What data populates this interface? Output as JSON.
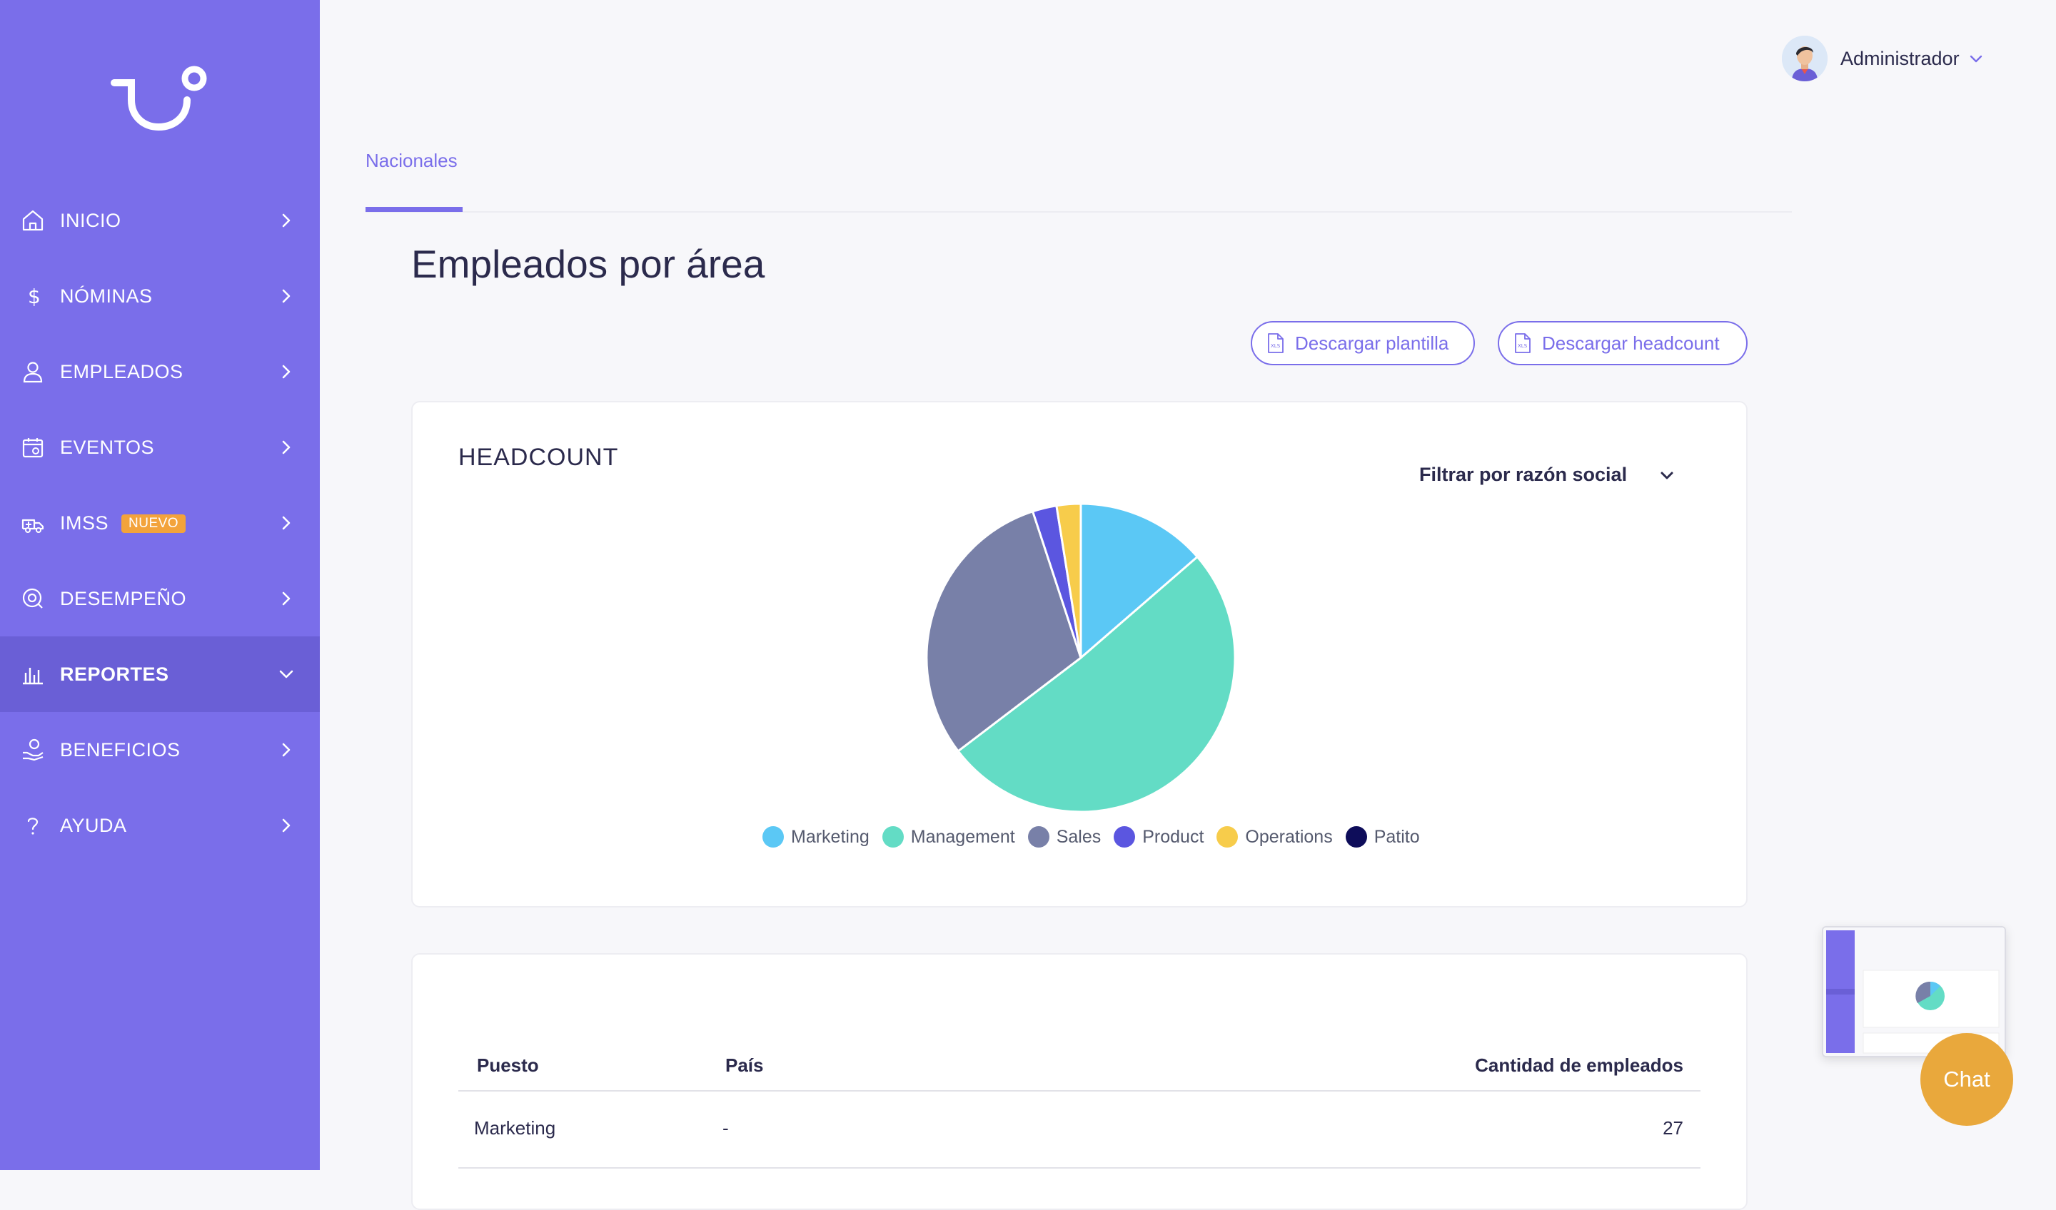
{
  "sidebar": {
    "items": [
      {
        "label": "INICIO",
        "icon": "home-icon"
      },
      {
        "label": "NÓMINAS",
        "icon": "dollar-icon"
      },
      {
        "label": "EMPLEADOS",
        "icon": "user-icon"
      },
      {
        "label": "EVENTOS",
        "icon": "calendar-icon"
      },
      {
        "label": "IMSS",
        "icon": "ambulance-icon",
        "badge": "NUEVO"
      },
      {
        "label": "DESEMPEÑO",
        "icon": "performance-icon"
      },
      {
        "label": "REPORTES",
        "icon": "bar-chart-icon",
        "active": true
      },
      {
        "label": "BENEFICIOS",
        "icon": "hand-coin-icon"
      },
      {
        "label": "AYUDA",
        "icon": "question-icon"
      }
    ]
  },
  "header": {
    "user_name": "Administrador"
  },
  "tabs": [
    {
      "label": "Nacionales",
      "active": true
    }
  ],
  "page": {
    "title": "Empleados por área"
  },
  "actions": {
    "download_template": "Descargar plantilla",
    "download_headcount": "Descargar headcount"
  },
  "headcount": {
    "title": "HEADCOUNT",
    "filter_label": "Filtrar por razón social"
  },
  "chart_data": {
    "type": "pie",
    "title": "HEADCOUNT",
    "categories": [
      "Marketing",
      "Management",
      "Sales",
      "Product",
      "Operations",
      "Patito"
    ],
    "values": [
      27,
      101,
      60,
      5,
      5,
      0
    ],
    "colors": [
      "#5bc8f5",
      "#63dcc5",
      "#7880a8",
      "#5b56e0",
      "#f7cc4b",
      "#0e0d5a"
    ],
    "legend": "bottom"
  },
  "table": {
    "headers": [
      "Puesto",
      "País",
      "Cantidad de empleados"
    ],
    "rows": [
      {
        "puesto": "Marketing",
        "pais": "-",
        "cantidad": "27"
      }
    ]
  },
  "chat": {
    "label": "Chat"
  },
  "colors": {
    "sidebar": "#7a6eea",
    "sidebar_active": "#6a5fd6",
    "accent": "#7a6eea",
    "badge": "#f3a33b",
    "chat": "#e9a83c"
  }
}
